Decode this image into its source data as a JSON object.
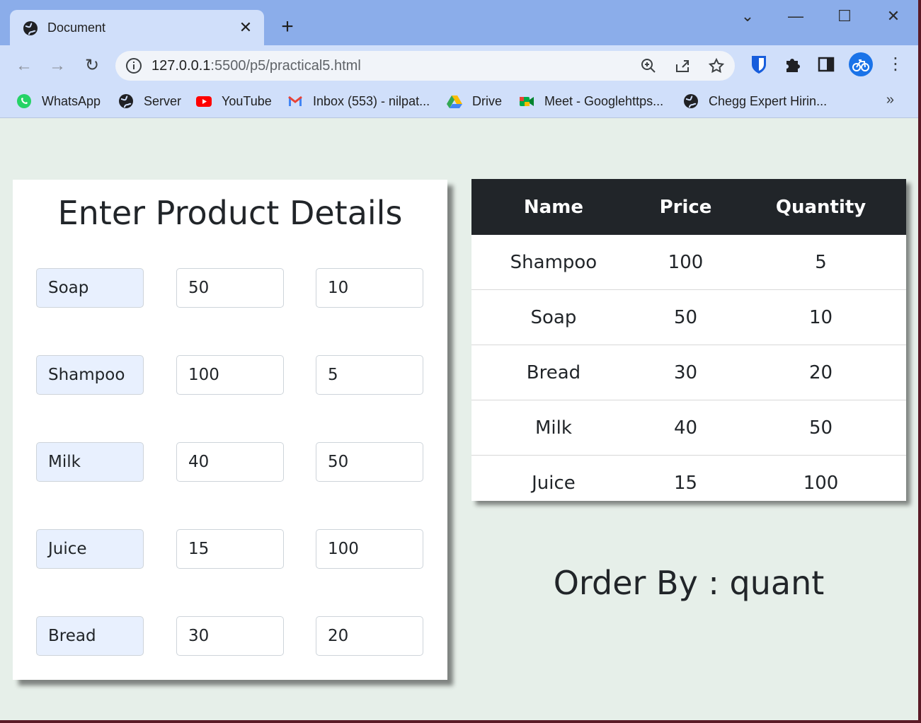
{
  "browser": {
    "tab_title": "Document",
    "url_host": "127.0.0.1",
    "url_rest": ":5500/p5/practical5.html",
    "bookmarks": [
      {
        "label": "WhatsApp",
        "icon": "whatsapp-icon"
      },
      {
        "label": "Server",
        "icon": "globe-icon"
      },
      {
        "label": "YouTube",
        "icon": "youtube-icon"
      },
      {
        "label": "Inbox (553) - nilpat...",
        "icon": "gmail-icon"
      },
      {
        "label": "Drive",
        "icon": "drive-icon"
      },
      {
        "label": "Meet - Googlehttps...",
        "icon": "meet-icon"
      },
      {
        "label": "Chegg Expert Hirin...",
        "icon": "globe-icon"
      }
    ],
    "bookmarks_overflow": "»"
  },
  "form": {
    "title": "Enter Product Details",
    "rows": [
      {
        "name": "Soap",
        "price": "50",
        "quantity": "10"
      },
      {
        "name": "Shampoo",
        "price": "100",
        "quantity": "5"
      },
      {
        "name": "Milk",
        "price": "40",
        "quantity": "50"
      },
      {
        "name": "Juice",
        "price": "15",
        "quantity": "100"
      },
      {
        "name": "Bread",
        "price": "30",
        "quantity": "20"
      }
    ]
  },
  "table": {
    "headers": [
      "Name",
      "Price",
      "Quantity"
    ],
    "rows": [
      [
        "Shampoo",
        "100",
        "5"
      ],
      [
        "Soap",
        "50",
        "10"
      ],
      [
        "Bread",
        "30",
        "20"
      ],
      [
        "Milk",
        "40",
        "50"
      ],
      [
        "Juice",
        "15",
        "100"
      ]
    ]
  },
  "order_by": "Order By : quant",
  "colors": {
    "tab_strip": "#8badea",
    "toolbar": "#d0dffa",
    "page_bg": "#e6efe9",
    "table_header": "#212529",
    "name_input_bg": "#e8f0fe"
  }
}
